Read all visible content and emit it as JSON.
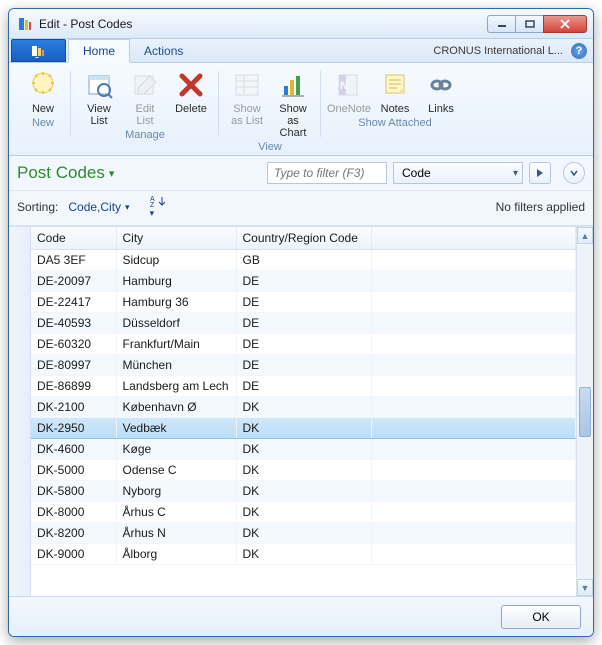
{
  "window": {
    "title": "Edit - Post Codes"
  },
  "menubar": {
    "tabs": [
      "Home",
      "Actions"
    ],
    "org": "CRONUS International L..."
  },
  "ribbon": {
    "groups": [
      {
        "label": "New",
        "items": [
          {
            "label": "New",
            "icon": "new",
            "enabled": true
          }
        ]
      },
      {
        "label": "Manage",
        "items": [
          {
            "label": "View List",
            "icon": "viewlist",
            "enabled": true
          },
          {
            "label": "Edit List",
            "icon": "editlist",
            "enabled": false
          },
          {
            "label": "Delete",
            "icon": "delete",
            "enabled": true
          }
        ]
      },
      {
        "label": "View",
        "items": [
          {
            "label": "Show as List",
            "icon": "showlist",
            "enabled": false
          },
          {
            "label": "Show as Chart",
            "icon": "showchart",
            "enabled": true
          }
        ]
      },
      {
        "label": "Show Attached",
        "items": [
          {
            "label": "OneNote",
            "icon": "onenote",
            "enabled": false
          },
          {
            "label": "Notes",
            "icon": "notes",
            "enabled": true
          },
          {
            "label": "Links",
            "icon": "links",
            "enabled": true
          }
        ]
      }
    ]
  },
  "page": {
    "title": "Post Codes",
    "filter_placeholder": "Type to filter (F3)",
    "filter_field": "Code",
    "no_filters": "No filters applied"
  },
  "sorting": {
    "label": "Sorting:",
    "value": "Code,City"
  },
  "grid": {
    "columns": [
      "Code",
      "City",
      "Country/Region Code"
    ],
    "selected_index": 8,
    "rows": [
      {
        "code": "DA5 3EF",
        "city": "Sidcup",
        "country": "GB"
      },
      {
        "code": "DE-20097",
        "city": "Hamburg",
        "country": "DE"
      },
      {
        "code": "DE-22417",
        "city": "Hamburg 36",
        "country": "DE"
      },
      {
        "code": "DE-40593",
        "city": "Düsseldorf",
        "country": "DE"
      },
      {
        "code": "DE-60320",
        "city": "Frankfurt/Main",
        "country": "DE"
      },
      {
        "code": "DE-80997",
        "city": "München",
        "country": "DE"
      },
      {
        "code": "DE-86899",
        "city": "Landsberg am Lech",
        "country": "DE"
      },
      {
        "code": "DK-2100",
        "city": "København Ø",
        "country": "DK"
      },
      {
        "code": "DK-2950",
        "city": "Vedbæk",
        "country": "DK"
      },
      {
        "code": "DK-4600",
        "city": "Køge",
        "country": "DK"
      },
      {
        "code": "DK-5000",
        "city": "Odense C",
        "country": "DK"
      },
      {
        "code": "DK-5800",
        "city": "Nyborg",
        "country": "DK"
      },
      {
        "code": "DK-8000",
        "city": "Århus C",
        "country": "DK"
      },
      {
        "code": "DK-8200",
        "city": "Århus N",
        "country": "DK"
      },
      {
        "code": "DK-9000",
        "city": "Ålborg",
        "country": "DK"
      }
    ]
  },
  "footer": {
    "ok": "OK"
  }
}
